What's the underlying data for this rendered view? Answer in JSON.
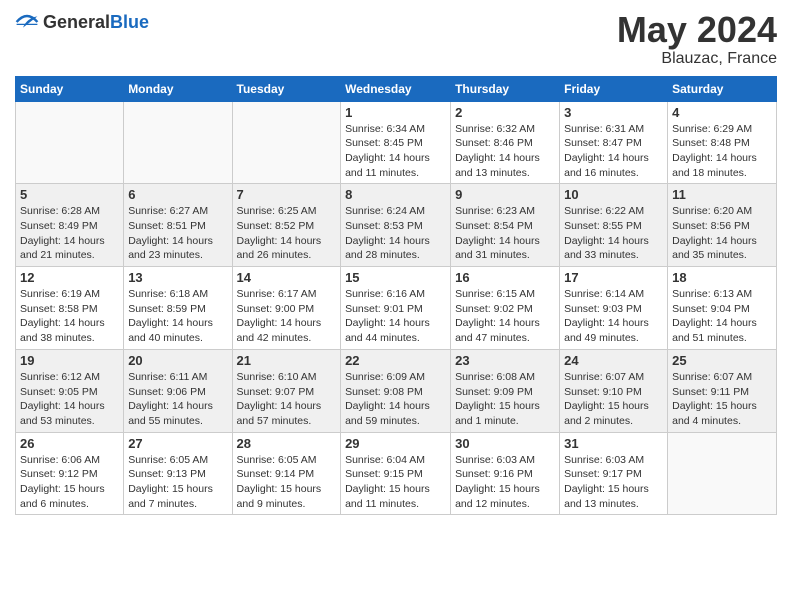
{
  "header": {
    "logo": {
      "general": "General",
      "blue": "Blue"
    },
    "month": "May 2024",
    "location": "Blauzac, France"
  },
  "days_of_week": [
    "Sunday",
    "Monday",
    "Tuesday",
    "Wednesday",
    "Thursday",
    "Friday",
    "Saturday"
  ],
  "weeks": [
    [
      {
        "day": "",
        "info": ""
      },
      {
        "day": "",
        "info": ""
      },
      {
        "day": "",
        "info": ""
      },
      {
        "day": "1",
        "info": "Sunrise: 6:34 AM\nSunset: 8:45 PM\nDaylight: 14 hours\nand 11 minutes."
      },
      {
        "day": "2",
        "info": "Sunrise: 6:32 AM\nSunset: 8:46 PM\nDaylight: 14 hours\nand 13 minutes."
      },
      {
        "day": "3",
        "info": "Sunrise: 6:31 AM\nSunset: 8:47 PM\nDaylight: 14 hours\nand 16 minutes."
      },
      {
        "day": "4",
        "info": "Sunrise: 6:29 AM\nSunset: 8:48 PM\nDaylight: 14 hours\nand 18 minutes."
      }
    ],
    [
      {
        "day": "5",
        "info": "Sunrise: 6:28 AM\nSunset: 8:49 PM\nDaylight: 14 hours\nand 21 minutes."
      },
      {
        "day": "6",
        "info": "Sunrise: 6:27 AM\nSunset: 8:51 PM\nDaylight: 14 hours\nand 23 minutes."
      },
      {
        "day": "7",
        "info": "Sunrise: 6:25 AM\nSunset: 8:52 PM\nDaylight: 14 hours\nand 26 minutes."
      },
      {
        "day": "8",
        "info": "Sunrise: 6:24 AM\nSunset: 8:53 PM\nDaylight: 14 hours\nand 28 minutes."
      },
      {
        "day": "9",
        "info": "Sunrise: 6:23 AM\nSunset: 8:54 PM\nDaylight: 14 hours\nand 31 minutes."
      },
      {
        "day": "10",
        "info": "Sunrise: 6:22 AM\nSunset: 8:55 PM\nDaylight: 14 hours\nand 33 minutes."
      },
      {
        "day": "11",
        "info": "Sunrise: 6:20 AM\nSunset: 8:56 PM\nDaylight: 14 hours\nand 35 minutes."
      }
    ],
    [
      {
        "day": "12",
        "info": "Sunrise: 6:19 AM\nSunset: 8:58 PM\nDaylight: 14 hours\nand 38 minutes."
      },
      {
        "day": "13",
        "info": "Sunrise: 6:18 AM\nSunset: 8:59 PM\nDaylight: 14 hours\nand 40 minutes."
      },
      {
        "day": "14",
        "info": "Sunrise: 6:17 AM\nSunset: 9:00 PM\nDaylight: 14 hours\nand 42 minutes."
      },
      {
        "day": "15",
        "info": "Sunrise: 6:16 AM\nSunset: 9:01 PM\nDaylight: 14 hours\nand 44 minutes."
      },
      {
        "day": "16",
        "info": "Sunrise: 6:15 AM\nSunset: 9:02 PM\nDaylight: 14 hours\nand 47 minutes."
      },
      {
        "day": "17",
        "info": "Sunrise: 6:14 AM\nSunset: 9:03 PM\nDaylight: 14 hours\nand 49 minutes."
      },
      {
        "day": "18",
        "info": "Sunrise: 6:13 AM\nSunset: 9:04 PM\nDaylight: 14 hours\nand 51 minutes."
      }
    ],
    [
      {
        "day": "19",
        "info": "Sunrise: 6:12 AM\nSunset: 9:05 PM\nDaylight: 14 hours\nand 53 minutes."
      },
      {
        "day": "20",
        "info": "Sunrise: 6:11 AM\nSunset: 9:06 PM\nDaylight: 14 hours\nand 55 minutes."
      },
      {
        "day": "21",
        "info": "Sunrise: 6:10 AM\nSunset: 9:07 PM\nDaylight: 14 hours\nand 57 minutes."
      },
      {
        "day": "22",
        "info": "Sunrise: 6:09 AM\nSunset: 9:08 PM\nDaylight: 14 hours\nand 59 minutes."
      },
      {
        "day": "23",
        "info": "Sunrise: 6:08 AM\nSunset: 9:09 PM\nDaylight: 15 hours\nand 1 minute."
      },
      {
        "day": "24",
        "info": "Sunrise: 6:07 AM\nSunset: 9:10 PM\nDaylight: 15 hours\nand 2 minutes."
      },
      {
        "day": "25",
        "info": "Sunrise: 6:07 AM\nSunset: 9:11 PM\nDaylight: 15 hours\nand 4 minutes."
      }
    ],
    [
      {
        "day": "26",
        "info": "Sunrise: 6:06 AM\nSunset: 9:12 PM\nDaylight: 15 hours\nand 6 minutes."
      },
      {
        "day": "27",
        "info": "Sunrise: 6:05 AM\nSunset: 9:13 PM\nDaylight: 15 hours\nand 7 minutes."
      },
      {
        "day": "28",
        "info": "Sunrise: 6:05 AM\nSunset: 9:14 PM\nDaylight: 15 hours\nand 9 minutes."
      },
      {
        "day": "29",
        "info": "Sunrise: 6:04 AM\nSunset: 9:15 PM\nDaylight: 15 hours\nand 11 minutes."
      },
      {
        "day": "30",
        "info": "Sunrise: 6:03 AM\nSunset: 9:16 PM\nDaylight: 15 hours\nand 12 minutes."
      },
      {
        "day": "31",
        "info": "Sunrise: 6:03 AM\nSunset: 9:17 PM\nDaylight: 15 hours\nand 13 minutes."
      },
      {
        "day": "",
        "info": ""
      }
    ]
  ]
}
